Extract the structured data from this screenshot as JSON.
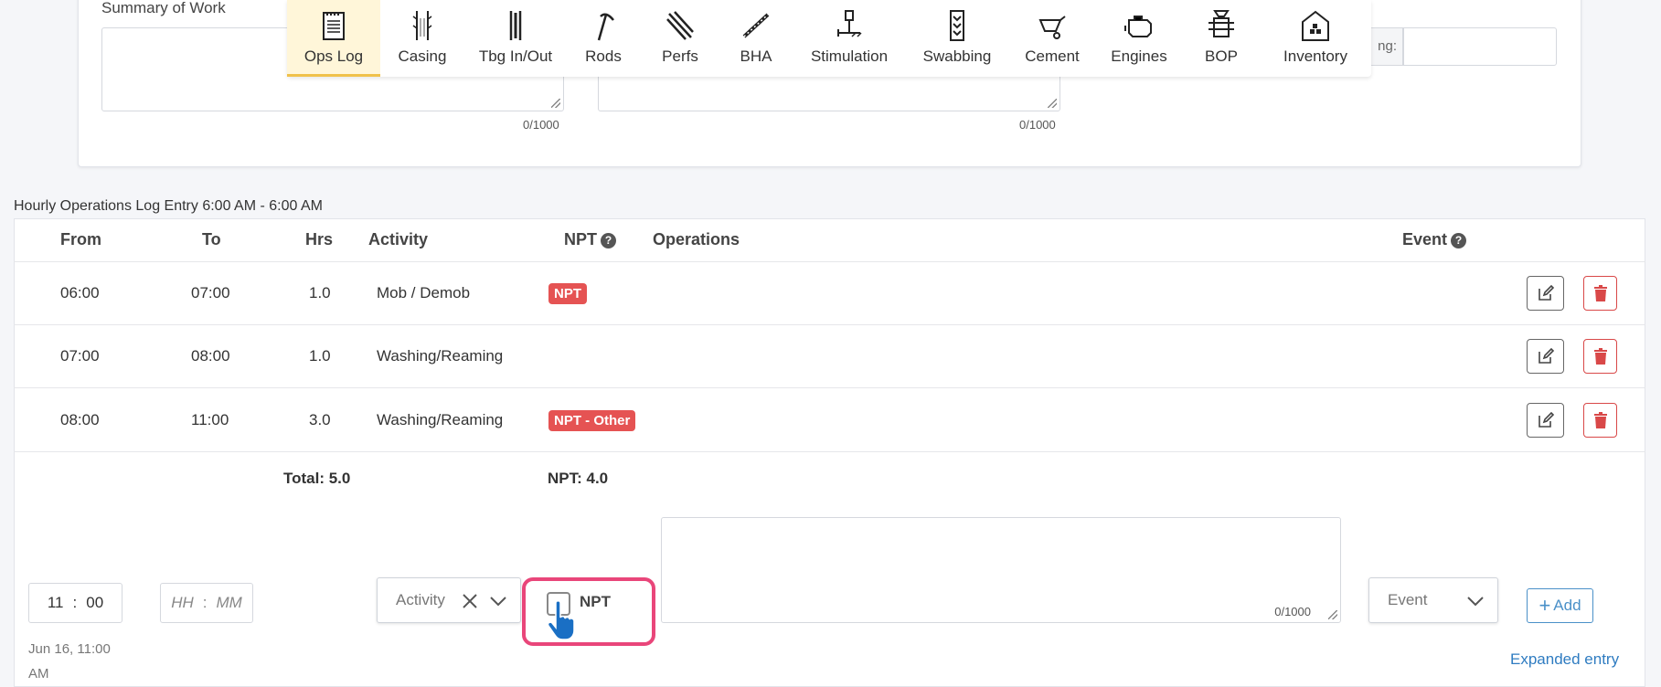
{
  "summary": {
    "title": "Summary of Work",
    "counter_left": "0/1000",
    "counter_right": "0/1000",
    "right_label": "ng:"
  },
  "toolbar": {
    "items": [
      {
        "label": "Ops Log",
        "icon": "notepad-icon"
      },
      {
        "label": "Casing",
        "icon": "casing-icon"
      },
      {
        "label": "Tbg In/Out",
        "icon": "tubing-icon"
      },
      {
        "label": "Rods",
        "icon": "rods-icon"
      },
      {
        "label": "Perfs",
        "icon": "perforation-icon"
      },
      {
        "label": "BHA",
        "icon": "bha-icon"
      },
      {
        "label": "Stimulation",
        "icon": "stimulation-icon"
      },
      {
        "label": "Swabbing",
        "icon": "swabbing-icon"
      },
      {
        "label": "Cement",
        "icon": "wheelbarrow-icon"
      },
      {
        "label": "Engines",
        "icon": "engine-icon"
      },
      {
        "label": "BOP",
        "icon": "bop-icon"
      },
      {
        "label": "Inventory",
        "icon": "warehouse-icon"
      }
    ],
    "active": "Ops Log"
  },
  "log": {
    "title": "Hourly Operations Log Entry 6:00 AM - 6:00 AM",
    "headers": {
      "from": "From",
      "to": "To",
      "hrs": "Hrs",
      "activity": "Activity",
      "npt": "NPT",
      "operations": "Operations",
      "event": "Event"
    },
    "rows": [
      {
        "from": "06:00",
        "to": "07:00",
        "hrs": "1.0",
        "activity": "Mob / Demob",
        "npt": "NPT"
      },
      {
        "from": "07:00",
        "to": "08:00",
        "hrs": "1.0",
        "activity": "Washing/Reaming",
        "npt": ""
      },
      {
        "from": "08:00",
        "to": "11:00",
        "hrs": "3.0",
        "activity": "Washing/Reaming",
        "npt": "NPT - Other"
      }
    ],
    "total": "Total: 5.0",
    "npt_total": "NPT: 4.0"
  },
  "entry": {
    "from_hh": "11",
    "from_mm": "00",
    "to_hh_placeholder": "HH",
    "to_mm_placeholder": "MM",
    "timestamp_line1": "Jun 16, 11:00",
    "timestamp_line2": "AM",
    "activity_placeholder": "Activity",
    "npt_label": "NPT",
    "ops_counter": "0/1000",
    "event_placeholder": "Event",
    "add_label": "Add",
    "expanded_link": "Expanded entry"
  },
  "colors": {
    "badge_red": "#e55353",
    "highlight_pink": "#e9467a",
    "link_blue": "#2f7cc1",
    "active_tab": "#fff6d9"
  }
}
